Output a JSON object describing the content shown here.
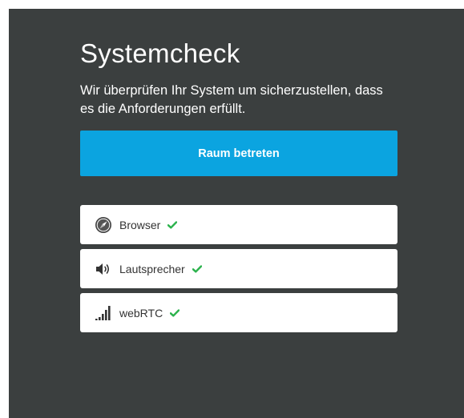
{
  "page": {
    "title": "Systemcheck",
    "description": "Wir überprüfen Ihr System um sicherzustellen, dass es die Anforderungen erfüllt.",
    "enter_button_label": "Raum betreten"
  },
  "checks": [
    {
      "label": "Browser",
      "icon": "compass-icon",
      "status": "ok"
    },
    {
      "label": "Lautsprecher",
      "icon": "speaker-icon",
      "status": "ok"
    },
    {
      "label": "webRTC",
      "icon": "signal-bars-icon",
      "status": "ok"
    }
  ],
  "colors": {
    "background": "#3b3f3f",
    "accent": "#0ba4e0",
    "success": "#2bb24c"
  }
}
